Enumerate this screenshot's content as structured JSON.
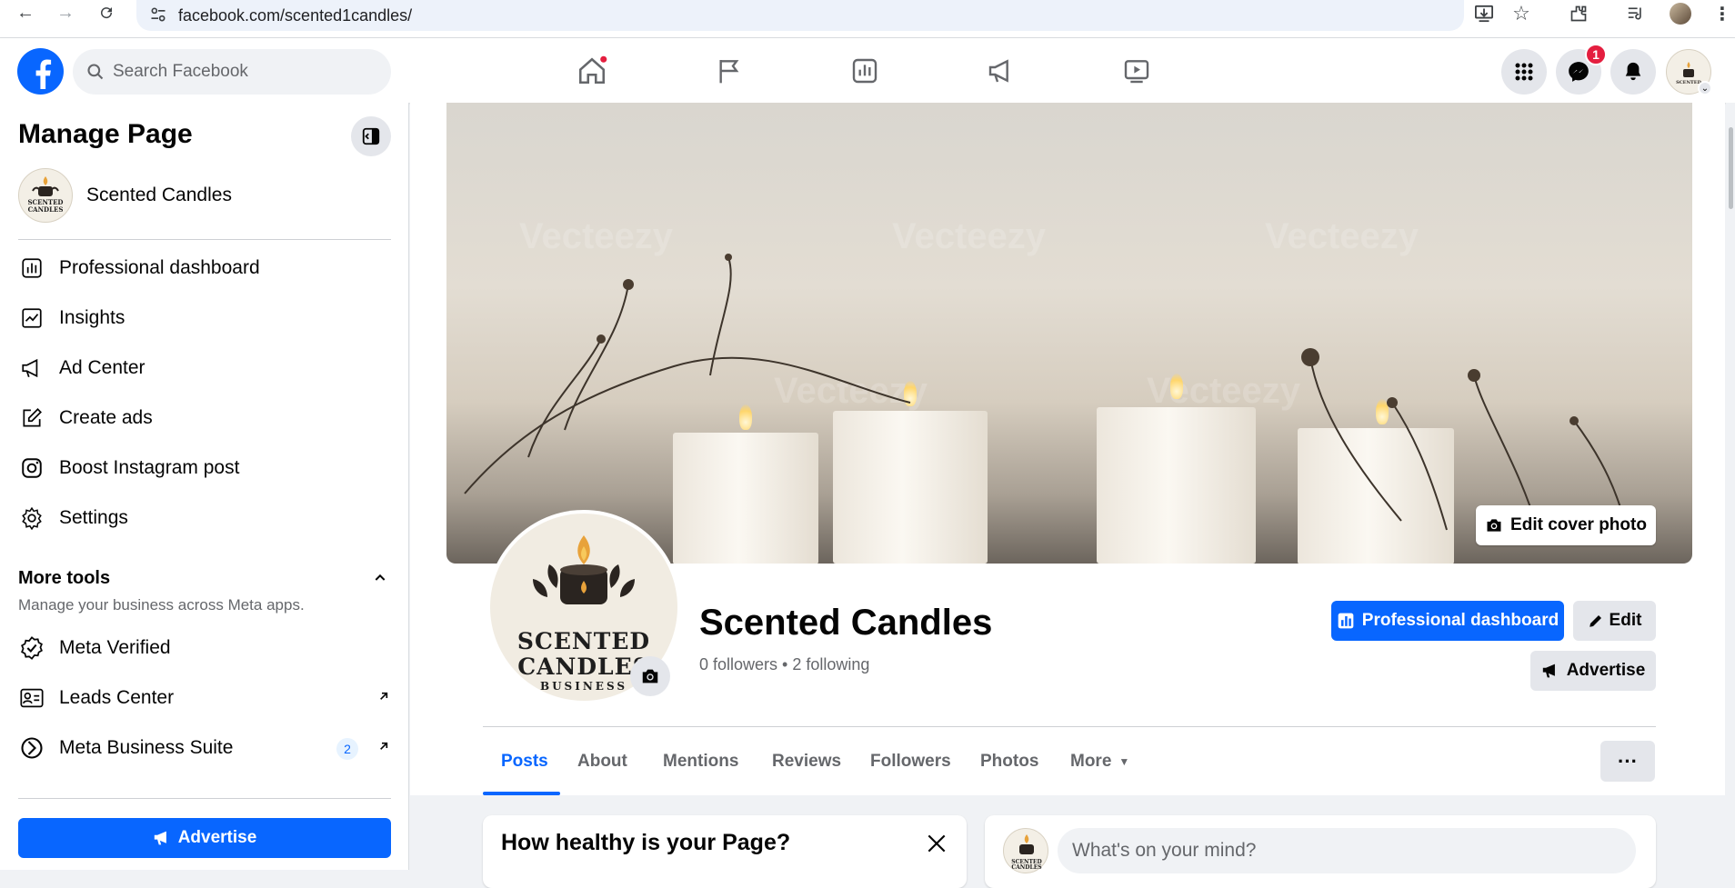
{
  "browser": {
    "url": "facebook.com/scented1candles/"
  },
  "header": {
    "search_placeholder": "Search Facebook",
    "messenger_badge": "1"
  },
  "sidebar": {
    "title": "Manage Page",
    "page_name": "Scented Candles",
    "items": [
      {
        "label": "Professional dashboard",
        "icon": "dashboard-icon"
      },
      {
        "label": "Insights",
        "icon": "insights-icon"
      },
      {
        "label": "Ad Center",
        "icon": "megaphone-icon"
      },
      {
        "label": "Create ads",
        "icon": "pencil-square-icon"
      },
      {
        "label": "Boost Instagram post",
        "icon": "instagram-icon"
      },
      {
        "label": "Settings",
        "icon": "gear-icon"
      }
    ],
    "more_tools": {
      "title": "More tools",
      "subtitle": "Manage your business across Meta apps.",
      "items": [
        {
          "label": "Meta Verified",
          "icon": "verified-badge-icon"
        },
        {
          "label": "Leads Center",
          "icon": "contact-card-icon"
        },
        {
          "label": "Meta Business Suite",
          "icon": "business-suite-icon",
          "count": "2"
        }
      ]
    },
    "advertise_label": "Advertise"
  },
  "page": {
    "edit_cover_label": "Edit cover photo",
    "name": "Scented Candles",
    "stats": "0 followers • 2 following",
    "logo_title_line1": "SCENTED",
    "logo_title_line2": "CANDLES",
    "logo_subtitle": "BUSINESS",
    "professional_dashboard_label": "Professional dashboard",
    "edit_label": "Edit",
    "advertise_label": "Advertise",
    "watermark": "Vecteezy"
  },
  "tabs": [
    {
      "label": "Posts",
      "active": true
    },
    {
      "label": "About"
    },
    {
      "label": "Mentions"
    },
    {
      "label": "Reviews"
    },
    {
      "label": "Followers"
    },
    {
      "label": "Photos"
    },
    {
      "label": "More"
    }
  ],
  "health_card": {
    "title": "How healthy is your Page?"
  },
  "composer": {
    "placeholder": "What's on your mind?"
  },
  "colors": {
    "brand": "#0866ff",
    "badge": "#e41e3f",
    "grey_button": "#e4e6eb"
  }
}
